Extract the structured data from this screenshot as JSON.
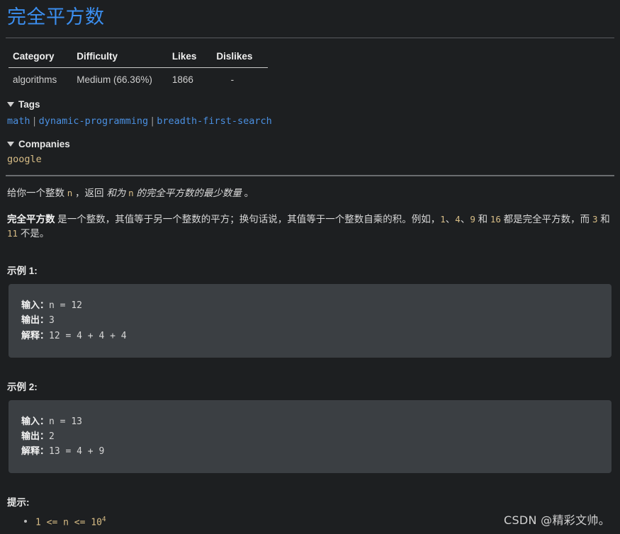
{
  "page": {
    "title": "完全平方数",
    "accent_color": "#3b8eef",
    "background_color": "#1d1f21",
    "code_block_color": "#3b3f43",
    "code_text_color": "#d8bd86"
  },
  "meta_table": {
    "headers": [
      "Category",
      "Difficulty",
      "Likes",
      "Dislikes"
    ],
    "rows": [
      {
        "category": "algorithms",
        "difficulty": "Medium (66.36%)",
        "likes": "1866",
        "dislikes": "-"
      }
    ]
  },
  "tags_section": {
    "caret": "caret-down-icon",
    "label": "Tags",
    "items": [
      "math",
      "dynamic-programming",
      "breadth-first-search"
    ],
    "separator": "|"
  },
  "companies_section": {
    "caret": "caret-down-icon",
    "label": "Companies",
    "items": [
      "google"
    ]
  },
  "description": {
    "p1": {
      "t1": "给你一个整数 ",
      "c1": "n",
      "t2": " ，返回 ",
      "i1": "和为 ",
      "ic1": "n",
      "i2": " 的完全平方数的最少数量",
      "t3": " 。"
    },
    "p2": {
      "b1": "完全平方数",
      "t1": " 是一个整数，其值等于另一个整数的平方；换句话说，其值等于一个整数自乘的积。例如，",
      "c1": "1",
      "t2": "、",
      "c2": "4",
      "t3": "、",
      "c3": "9",
      "t4": " 和 ",
      "c4": "16",
      "t5": " 都是完全平方数，而 ",
      "c5": "3",
      "t6": " 和 ",
      "c6": "11",
      "t7": " 不是。"
    }
  },
  "examples": [
    {
      "label": "示例 1:",
      "input_label": "输入：",
      "input_value": "n = 12",
      "output_label": "输出：",
      "output_value": "3",
      "explain_label": "解释：",
      "explain_value": "12 = 4 + 4 + 4"
    },
    {
      "label": "示例 2:",
      "input_label": "输入：",
      "input_value": "n = 13",
      "output_label": "输出：",
      "output_value": "2",
      "explain_label": "解释：",
      "explain_value": "13 = 4 + 9"
    }
  ],
  "hints": {
    "label": "提示:",
    "items": [
      {
        "text": "1 <= n <= 10",
        "sup": "4"
      }
    ]
  },
  "watermark": "CSDN @精彩文帅。"
}
